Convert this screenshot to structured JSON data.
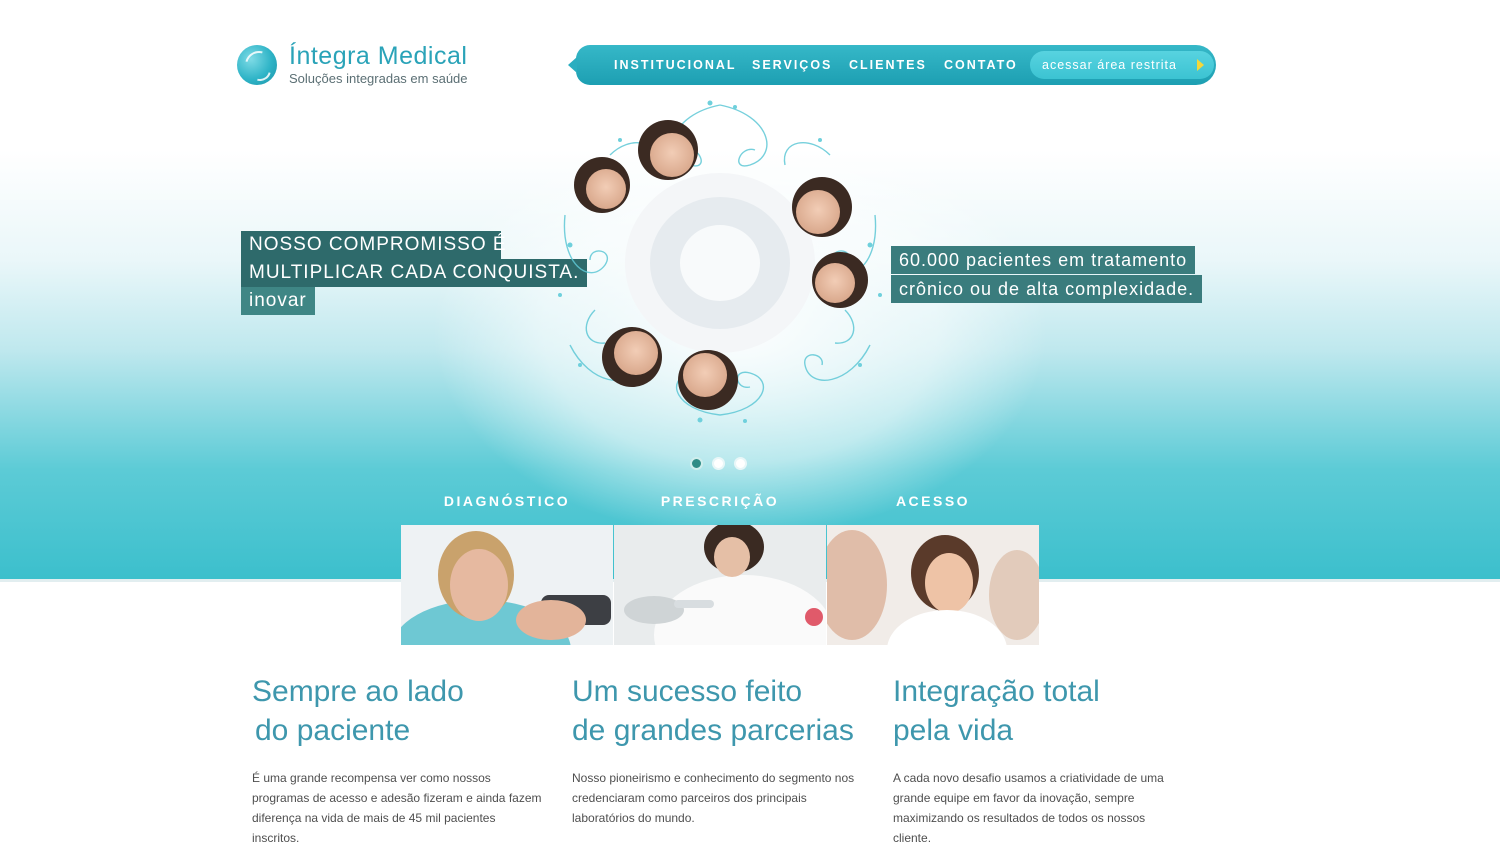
{
  "header": {
    "logo_title": "Íntegra Medical",
    "logo_subtitle": "Soluções integradas em saúde"
  },
  "nav": {
    "items": [
      "INSTITUCIONAL",
      "SERVIÇOS",
      "CLIENTES",
      "CONTATO"
    ],
    "restricted_label": "acessar área restrita"
  },
  "hero": {
    "left_caption": [
      "NOSSO COMPROMISSO É",
      "MULTIPLICAR CADA CONQUISTA.",
      "inovar"
    ],
    "right_caption": [
      "60.000 pacientes em tratamento",
      "crônico ou de alta complexidade."
    ],
    "slides_total": 3,
    "active_slide": 1
  },
  "pillars": [
    {
      "label": "DIAGNÓSTICO"
    },
    {
      "label": "PRESCRIÇÃO"
    },
    {
      "label": "ACESSO"
    }
  ],
  "columns": [
    {
      "title_line1": "Sempre ao lado",
      "title_line2": "do paciente",
      "text": "É uma grande recompensa ver como nossos programas de acesso e adesão fizeram e ainda fazem diferença na vida de mais de 45 mil pacientes inscritos."
    },
    {
      "title_line1": "Um sucesso feito",
      "title_line2": "de grandes parcerias",
      "text": "Nosso pioneirismo e conhecimento do segmento nos credenciaram como parceiros dos principais laboratórios do mundo."
    },
    {
      "title_line1": "Integração total",
      "title_line2": "pela vida",
      "text": "A cada novo desafio usamos a criatividade de uma grande equipe em favor da inovação, sempre maximizando os resultados de todos os nossos cliente."
    }
  ],
  "colors": {
    "accent": "#2aa3b8",
    "nav": "#1d9fb2",
    "caption_bg": "#2e6a6b",
    "title_text": "#3e97ad"
  }
}
